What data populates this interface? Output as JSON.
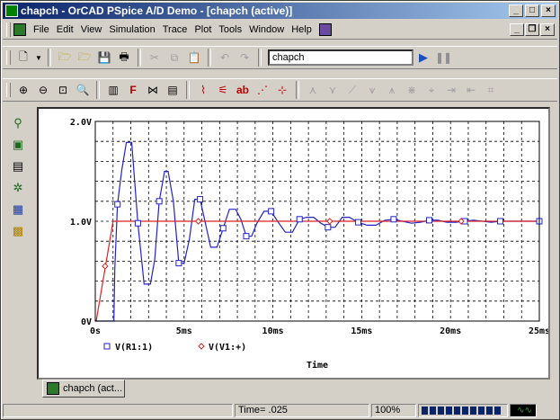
{
  "window": {
    "title": "chapch - OrCAD PSpice A/D Demo  - [chapch (active)]"
  },
  "menu": [
    "File",
    "Edit",
    "View",
    "Simulation",
    "Trace",
    "Plot",
    "Tools",
    "Window",
    "Help"
  ],
  "toolbar1": {
    "profile_combo": "chapch"
  },
  "plot": {
    "legend": [
      {
        "label": "V(R1:1)",
        "marker": "square",
        "color": "#2222cc"
      },
      {
        "label": "V(V1:+)",
        "marker": "diamond",
        "color": "#dd2222"
      }
    ]
  },
  "tab": {
    "label": "chapch (act..."
  },
  "status": {
    "time": "Time= .025",
    "zoom": "100%",
    "progress": 1.0
  },
  "chart_data": {
    "type": "line",
    "title": "",
    "xlabel": "Time",
    "ylabel": "",
    "xlim": [
      0,
      25
    ],
    "ylim": [
      0,
      2
    ],
    "x_unit": "ms",
    "x_ticks": [
      "0s",
      "5ms",
      "10ms",
      "15ms",
      "20ms",
      "25ms"
    ],
    "y_ticks": [
      "0V",
      "1.0V",
      "2.0V"
    ],
    "grid": true,
    "legend_position": "bottom-left",
    "series": [
      {
        "name": "V(R1:1)",
        "color": "#2222cc",
        "x": [
          0,
          1.05,
          1.1,
          1.25,
          1.5,
          1.75,
          2.05,
          2.4,
          2.75,
          3.1,
          3.35,
          3.6,
          3.9,
          4.1,
          4.4,
          4.7,
          5.0,
          5.3,
          5.6,
          5.9,
          6.2,
          6.5,
          6.85,
          7.2,
          7.55,
          7.9,
          8.2,
          8.5,
          8.8,
          9.1,
          9.5,
          9.9,
          10.3,
          10.7,
          11.1,
          11.5,
          11.9,
          12.3,
          12.7,
          13.1,
          13.5,
          13.9,
          14.3,
          14.8,
          15.3,
          15.8,
          16.3,
          16.8,
          17.3,
          17.8,
          18.3,
          18.8,
          19.3,
          19.8,
          20.3,
          20.8,
          21.3,
          21.8,
          22.3,
          22.8,
          23.3,
          23.8,
          24.3,
          25
        ],
        "y": [
          0,
          0,
          0.52,
          1.17,
          1.52,
          1.79,
          1.79,
          0.98,
          0.37,
          0.37,
          0.62,
          1.2,
          1.5,
          1.5,
          1.2,
          0.58,
          0.58,
          0.82,
          1.22,
          1.22,
          0.98,
          0.74,
          0.74,
          0.93,
          1.12,
          1.12,
          1.02,
          0.85,
          0.85,
          0.98,
          1.1,
          1.1,
          0.99,
          0.89,
          0.89,
          1.02,
          1.04,
          1.04,
          0.98,
          0.94,
          0.94,
          1.04,
          1.04,
          0.99,
          0.96,
          0.96,
          1.01,
          1.02,
          1.0,
          0.98,
          0.99,
          1.01,
          1.01,
          0.99,
          0.99,
          1.0,
          1.01,
          1.0,
          0.99,
          1.0,
          1.0,
          1.0,
          1.0,
          1.0
        ]
      },
      {
        "name": "V(V1:+)",
        "color": "#dd2222",
        "x": [
          0,
          0.05,
          1.0,
          25
        ],
        "y": [
          0,
          0,
          1.0,
          1.0
        ]
      }
    ]
  }
}
